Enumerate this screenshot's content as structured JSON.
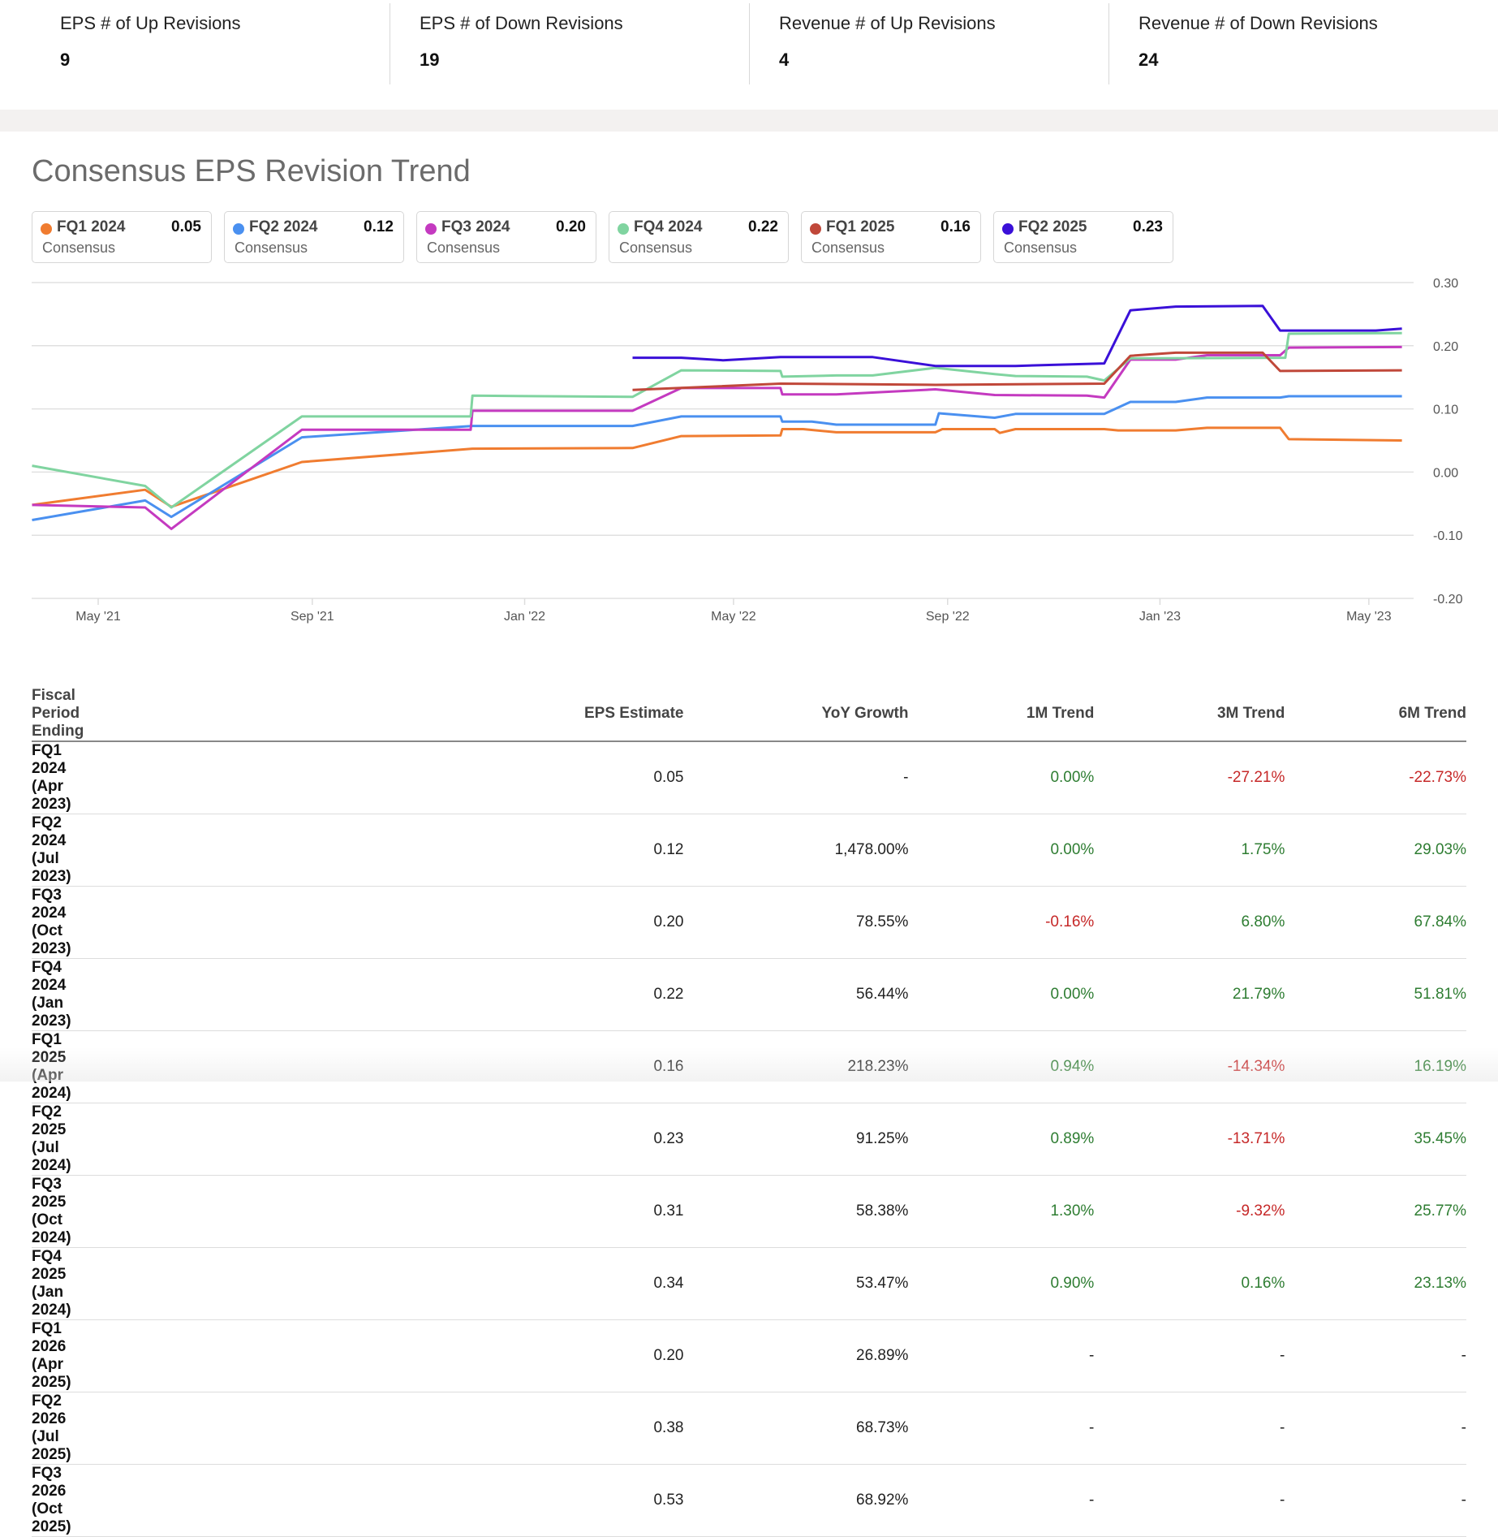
{
  "stats": [
    {
      "label": "EPS # of Up Revisions",
      "value": "9"
    },
    {
      "label": "EPS # of Down Revisions",
      "value": "19"
    },
    {
      "label": "Revenue # of Up Revisions",
      "value": "4"
    },
    {
      "label": "Revenue # of Down Revisions",
      "value": "24"
    }
  ],
  "chart_data": {
    "type": "line",
    "title": "Consensus EPS Revision Trend",
    "legend_placement": "top",
    "grid": true,
    "ylim": [
      -0.2,
      0.3
    ],
    "yticks": [
      "0.30",
      "0.20",
      "0.10",
      "0.00",
      "-0.10",
      "-0.20"
    ],
    "ytick_values": [
      0.3,
      0.2,
      0.1,
      0,
      -0.1,
      -0.2
    ],
    "xticks": [
      {
        "label": "May '21",
        "date": "2021-05-01"
      },
      {
        "label": "Sep '21",
        "date": "2021-09-01"
      },
      {
        "label": "Jan '22",
        "date": "2022-01-01"
      },
      {
        "label": "May '22",
        "date": "2022-05-01"
      },
      {
        "label": "Sep '22",
        "date": "2022-09-01"
      },
      {
        "label": "Jan '23",
        "date": "2023-01-01"
      },
      {
        "label": "May '23",
        "date": "2023-05-01"
      }
    ],
    "series": [
      {
        "name": "FQ1 2024",
        "latest": "0.05",
        "sublabel": "Consensus",
        "color": "#f07c30",
        "points": [
          [
            "2021-03-24",
            -0.052
          ],
          [
            "2021-05-28",
            -0.028
          ],
          [
            "2021-06-12",
            -0.055
          ],
          [
            "2021-08-26",
            0.016
          ],
          [
            "2021-12-02",
            0.037
          ],
          [
            "2022-03-04",
            0.038
          ],
          [
            "2022-04-01",
            0.057
          ],
          [
            "2022-05-28",
            0.058
          ],
          [
            "2022-05-29",
            0.068
          ],
          [
            "2022-06-10",
            0.068
          ],
          [
            "2022-06-29",
            0.063
          ],
          [
            "2022-08-25",
            0.063
          ],
          [
            "2022-08-29",
            0.068
          ],
          [
            "2022-09-28",
            0.068
          ],
          [
            "2022-10-01",
            0.062
          ],
          [
            "2022-10-10",
            0.068
          ],
          [
            "2022-11-30",
            0.068
          ],
          [
            "2022-12-08",
            0.066
          ],
          [
            "2023-01-10",
            0.066
          ],
          [
            "2023-01-28",
            0.07
          ],
          [
            "2023-03-11",
            0.07
          ],
          [
            "2023-03-16",
            0.052
          ],
          [
            "2023-05-20",
            0.05
          ]
        ]
      },
      {
        "name": "FQ2 2024",
        "latest": "0.12",
        "sublabel": "Consensus",
        "color": "#4a90f0",
        "points": [
          [
            "2021-03-24",
            -0.076
          ],
          [
            "2021-05-28",
            -0.045
          ],
          [
            "2021-06-12",
            -0.071
          ],
          [
            "2021-08-26",
            0.055
          ],
          [
            "2021-12-02",
            0.073
          ],
          [
            "2022-03-04",
            0.073
          ],
          [
            "2022-04-01",
            0.088
          ],
          [
            "2022-05-28",
            0.088
          ],
          [
            "2022-05-29",
            0.08
          ],
          [
            "2022-06-15",
            0.08
          ],
          [
            "2022-06-29",
            0.075
          ],
          [
            "2022-08-25",
            0.075
          ],
          [
            "2022-08-27",
            0.093
          ],
          [
            "2022-09-28",
            0.086
          ],
          [
            "2022-10-10",
            0.092
          ],
          [
            "2022-11-30",
            0.092
          ],
          [
            "2022-12-15",
            0.111
          ],
          [
            "2023-01-10",
            0.111
          ],
          [
            "2023-01-28",
            0.118
          ],
          [
            "2023-03-11",
            0.118
          ],
          [
            "2023-03-16",
            0.12
          ],
          [
            "2023-05-20",
            0.12
          ]
        ]
      },
      {
        "name": "FQ3 2024",
        "latest": "0.20",
        "sublabel": "Consensus",
        "color": "#c43ac0",
        "points": [
          [
            "2021-03-24",
            -0.052
          ],
          [
            "2021-05-28",
            -0.056
          ],
          [
            "2021-06-12",
            -0.09
          ],
          [
            "2021-08-26",
            0.067
          ],
          [
            "2021-12-01",
            0.067
          ],
          [
            "2021-12-02",
            0.097
          ],
          [
            "2022-03-04",
            0.097
          ],
          [
            "2022-04-01",
            0.133
          ],
          [
            "2022-05-28",
            0.133
          ],
          [
            "2022-05-29",
            0.123
          ],
          [
            "2022-06-29",
            0.123
          ],
          [
            "2022-08-25",
            0.131
          ],
          [
            "2022-09-28",
            0.122
          ],
          [
            "2022-11-20",
            0.121
          ],
          [
            "2022-11-30",
            0.118
          ],
          [
            "2022-12-15",
            0.178
          ],
          [
            "2023-01-10",
            0.178
          ],
          [
            "2023-01-28",
            0.185
          ],
          [
            "2023-03-11",
            0.185
          ],
          [
            "2023-03-16",
            0.197
          ],
          [
            "2023-05-20",
            0.198
          ]
        ]
      },
      {
        "name": "FQ4 2024",
        "latest": "0.22",
        "sublabel": "Consensus",
        "color": "#80d4a0",
        "points": [
          [
            "2021-03-24",
            0.01
          ],
          [
            "2021-05-28",
            -0.022
          ],
          [
            "2021-06-12",
            -0.056
          ],
          [
            "2021-08-26",
            0.088
          ],
          [
            "2021-12-01",
            0.088
          ],
          [
            "2021-12-02",
            0.121
          ],
          [
            "2022-03-04",
            0.119
          ],
          [
            "2022-04-01",
            0.161
          ],
          [
            "2022-05-28",
            0.16
          ],
          [
            "2022-05-29",
            0.151
          ],
          [
            "2022-06-29",
            0.153
          ],
          [
            "2022-07-20",
            0.153
          ],
          [
            "2022-08-25",
            0.165
          ],
          [
            "2022-09-28",
            0.155
          ],
          [
            "2022-10-10",
            0.152
          ],
          [
            "2022-11-20",
            0.151
          ],
          [
            "2022-11-30",
            0.145
          ],
          [
            "2022-12-15",
            0.18
          ],
          [
            "2023-03-14",
            0.181
          ],
          [
            "2023-03-16",
            0.219
          ],
          [
            "2023-05-20",
            0.22
          ]
        ]
      },
      {
        "name": "FQ1 2025",
        "latest": "0.16",
        "sublabel": "Consensus",
        "color": "#c0483a",
        "points": [
          [
            "2022-03-04",
            0.13
          ],
          [
            "2022-05-28",
            0.14
          ],
          [
            "2022-08-25",
            0.138
          ],
          [
            "2022-11-30",
            0.14
          ],
          [
            "2022-12-15",
            0.184
          ],
          [
            "2023-01-10",
            0.189
          ],
          [
            "2023-03-01",
            0.189
          ],
          [
            "2023-03-11",
            0.16
          ],
          [
            "2023-05-20",
            0.161
          ]
        ]
      },
      {
        "name": "FQ2 2025",
        "latest": "0.23",
        "sublabel": "Consensus",
        "color": "#3a10d8",
        "points": [
          [
            "2022-03-04",
            0.181
          ],
          [
            "2022-04-01",
            0.181
          ],
          [
            "2022-04-25",
            0.177
          ],
          [
            "2022-05-28",
            0.182
          ],
          [
            "2022-07-20",
            0.182
          ],
          [
            "2022-08-25",
            0.168
          ],
          [
            "2022-10-10",
            0.168
          ],
          [
            "2022-11-30",
            0.172
          ],
          [
            "2022-12-15",
            0.256
          ],
          [
            "2023-01-10",
            0.262
          ],
          [
            "2023-03-01",
            0.263
          ],
          [
            "2023-03-11",
            0.224
          ],
          [
            "2023-05-05",
            0.224
          ],
          [
            "2023-05-20",
            0.227
          ]
        ]
      }
    ]
  },
  "table": {
    "headers": [
      "Fiscal Period Ending",
      "EPS Estimate",
      "YoY Growth",
      "1M Trend",
      "3M Trend",
      "6M Trend"
    ],
    "rows": [
      [
        "FQ1 2024 (Apr 2023)",
        "0.05",
        "-",
        "0.00%",
        "-27.21%",
        "-22.73%"
      ],
      [
        "FQ2 2024 (Jul 2023)",
        "0.12",
        "1,478.00%",
        "0.00%",
        "1.75%",
        "29.03%"
      ],
      [
        "FQ3 2024 (Oct 2023)",
        "0.20",
        "78.55%",
        "-0.16%",
        "6.80%",
        "67.84%"
      ],
      [
        "FQ4 2024 (Jan 2023)",
        "0.22",
        "56.44%",
        "0.00%",
        "21.79%",
        "51.81%"
      ],
      [
        "FQ1 2025 (Apr 2024)",
        "0.16",
        "218.23%",
        "0.94%",
        "-14.34%",
        "16.19%"
      ],
      [
        "FQ2 2025 (Jul 2024)",
        "0.23",
        "91.25%",
        "0.89%",
        "-13.71%",
        "35.45%"
      ],
      [
        "FQ3 2025 (Oct 2024)",
        "0.31",
        "58.38%",
        "1.30%",
        "-9.32%",
        "25.77%"
      ],
      [
        "FQ4 2025 (Jan 2024)",
        "0.34",
        "53.47%",
        "0.90%",
        "0.16%",
        "23.13%"
      ],
      [
        "FQ1 2026 (Apr 2025)",
        "0.20",
        "26.89%",
        "-",
        "-",
        "-"
      ],
      [
        "FQ2 2026 (Jul 2025)",
        "0.38",
        "68.73%",
        "-",
        "-",
        "-"
      ],
      [
        "FQ3 2026 (Oct 2025)",
        "0.53",
        "68.92%",
        "-",
        "-",
        "-"
      ]
    ]
  }
}
